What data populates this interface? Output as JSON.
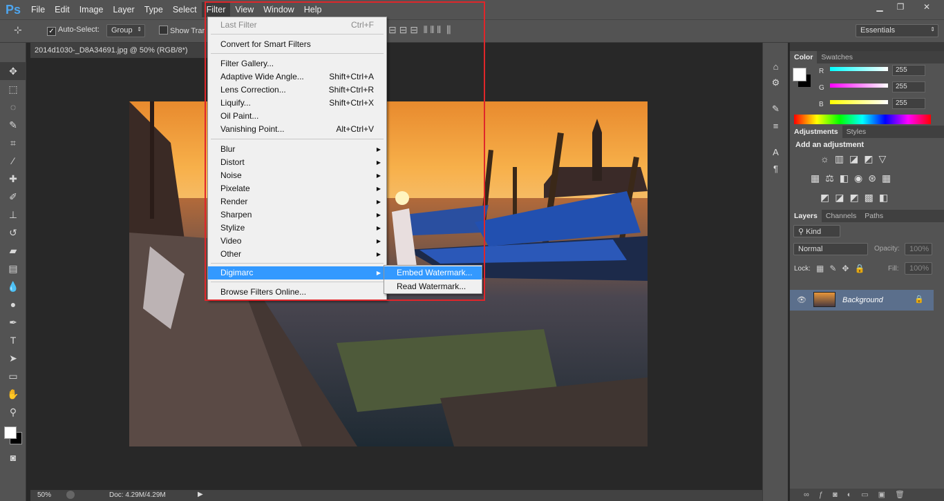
{
  "app": {
    "logo": "Ps"
  },
  "menubar": {
    "items": [
      "File",
      "Edit",
      "Image",
      "Layer",
      "Type",
      "Select",
      "Filter",
      "View",
      "Window",
      "Help"
    ],
    "active": "Filter"
  },
  "window_controls": {
    "minimize": "▁",
    "restore": "❐",
    "close": "✕"
  },
  "options": {
    "auto_select": "Auto-Select:",
    "group": "Group",
    "show_transform": "Show Tran",
    "workspace": "Essentials"
  },
  "document": {
    "tab_title": "2014d1030-_D8A34691.jpg @ 50% (RGB/8*)",
    "zoom": "50%",
    "doc_info": "Doc: 4.29M/4.29M"
  },
  "filter_menu": {
    "items": [
      {
        "label": "Last Filter",
        "shortcut": "Ctrl+F",
        "disabled": true
      },
      {
        "label": "Convert for Smart Filters",
        "shortcut": ""
      },
      {
        "label": "Filter Gallery...",
        "shortcut": ""
      },
      {
        "label": "Adaptive Wide Angle...",
        "shortcut": "Shift+Ctrl+A"
      },
      {
        "label": "Lens Correction...",
        "shortcut": "Shift+Ctrl+R"
      },
      {
        "label": "Liquify...",
        "shortcut": "Shift+Ctrl+X"
      },
      {
        "label": "Oil Paint...",
        "shortcut": ""
      },
      {
        "label": "Vanishing Point...",
        "shortcut": "Alt+Ctrl+V"
      },
      {
        "label": "Blur",
        "submenu": true
      },
      {
        "label": "Distort",
        "submenu": true
      },
      {
        "label": "Noise",
        "submenu": true
      },
      {
        "label": "Pixelate",
        "submenu": true
      },
      {
        "label": "Render",
        "submenu": true
      },
      {
        "label": "Sharpen",
        "submenu": true
      },
      {
        "label": "Stylize",
        "submenu": true
      },
      {
        "label": "Video",
        "submenu": true
      },
      {
        "label": "Other",
        "submenu": true
      },
      {
        "label": "Digimarc",
        "submenu": true,
        "highlighted": true
      },
      {
        "label": "Browse Filters Online...",
        "shortcut": ""
      }
    ]
  },
  "digimarc_submenu": {
    "items": [
      "Embed Watermark...",
      "Read Watermark..."
    ]
  },
  "color_panel": {
    "tabs": [
      "Color",
      "Swatches"
    ],
    "channels": [
      {
        "name": "R",
        "value": "255",
        "color": "#00ffff"
      },
      {
        "name": "G",
        "value": "255",
        "color": "#ff00ff"
      },
      {
        "name": "B",
        "value": "255",
        "color": "#ffff00"
      }
    ]
  },
  "adjustments_panel": {
    "tabs": [
      "Adjustments",
      "Styles"
    ],
    "heading": "Add an adjustment"
  },
  "layers_panel": {
    "tabs": [
      "Layers",
      "Channels",
      "Paths"
    ],
    "kind": "Kind",
    "blend_mode": "Normal",
    "opacity_label": "Opacity:",
    "opacity": "100%",
    "lock_label": "Lock:",
    "fill_label": "Fill:",
    "fill": "100%",
    "layer_name": "Background"
  },
  "colors": {
    "highlight": "#3399ff",
    "redbox": "#e0262a"
  }
}
